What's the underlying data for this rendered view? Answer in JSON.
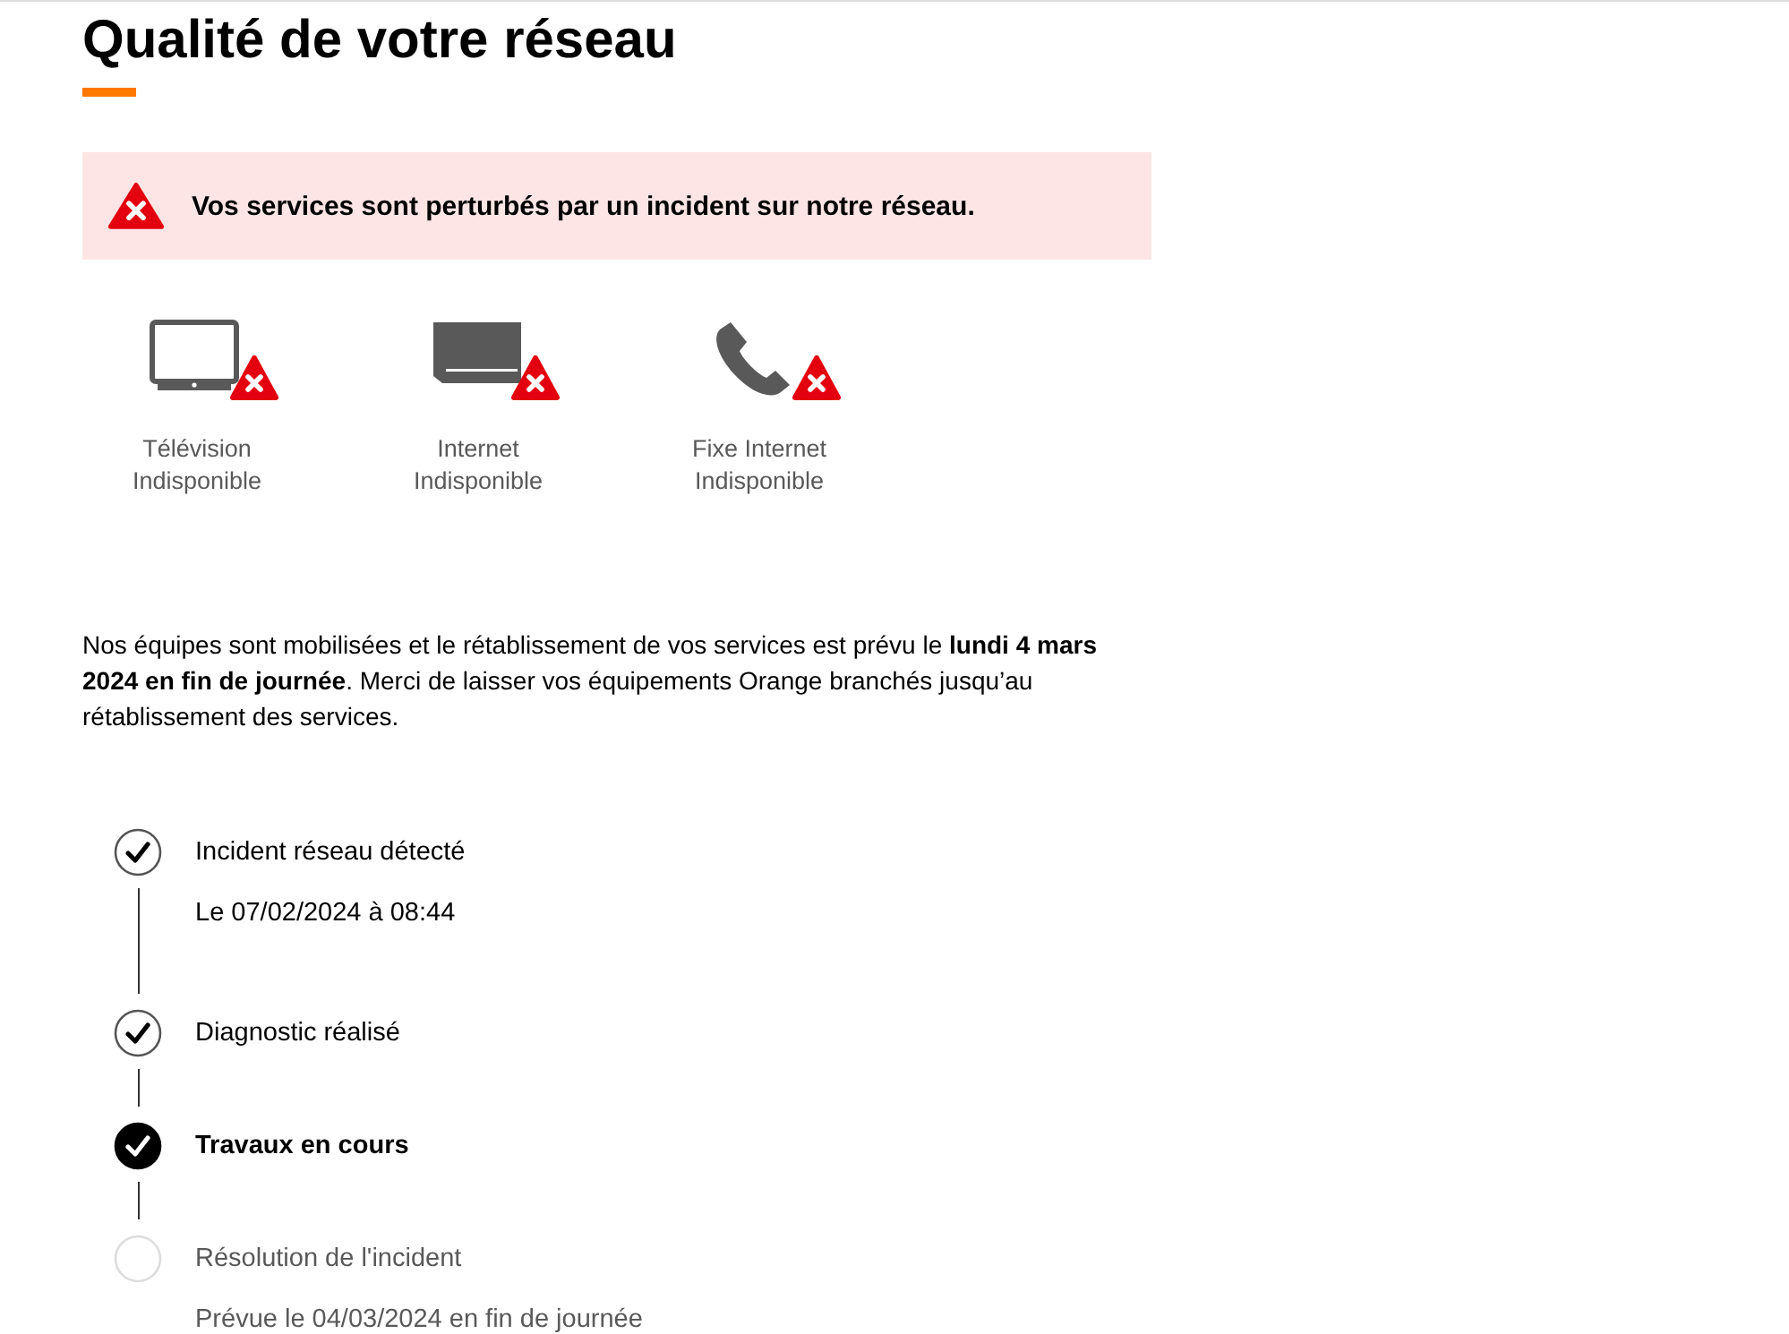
{
  "title": "Qualité de votre réseau",
  "alert": {
    "text": "Vos services sont perturbés par un incident sur notre réseau."
  },
  "services": [
    {
      "kind": "tv",
      "name": "Télévision",
      "status": "Indisponible"
    },
    {
      "kind": "box",
      "name": "Internet",
      "status": "Indisponible"
    },
    {
      "kind": "phone",
      "name": "Fixe Internet",
      "status": "Indisponible"
    }
  ],
  "message": "Nos équipes sont mobilisées et le rétablissement de vos services est prévu le **lundi 4 mars 2024 en fin de journée**. Merci de laisser vos équipements Orange branchés jusqu’au rétablissement des services.",
  "steps": [
    {
      "label": "Incident réseau détecté",
      "checked": true,
      "current": false,
      "detail": "Le 07/02/2024 à 08:44"
    },
    {
      "label": "Diagnostic réalisé",
      "checked": true,
      "current": false
    },
    {
      "label": "Travaux en cours",
      "checked": true,
      "current": true
    },
    {
      "label": "Résolution de l'incident",
      "checked": false,
      "current": false,
      "detail": "Prévue le 04/03/2024 en fin de journée"
    }
  ]
}
